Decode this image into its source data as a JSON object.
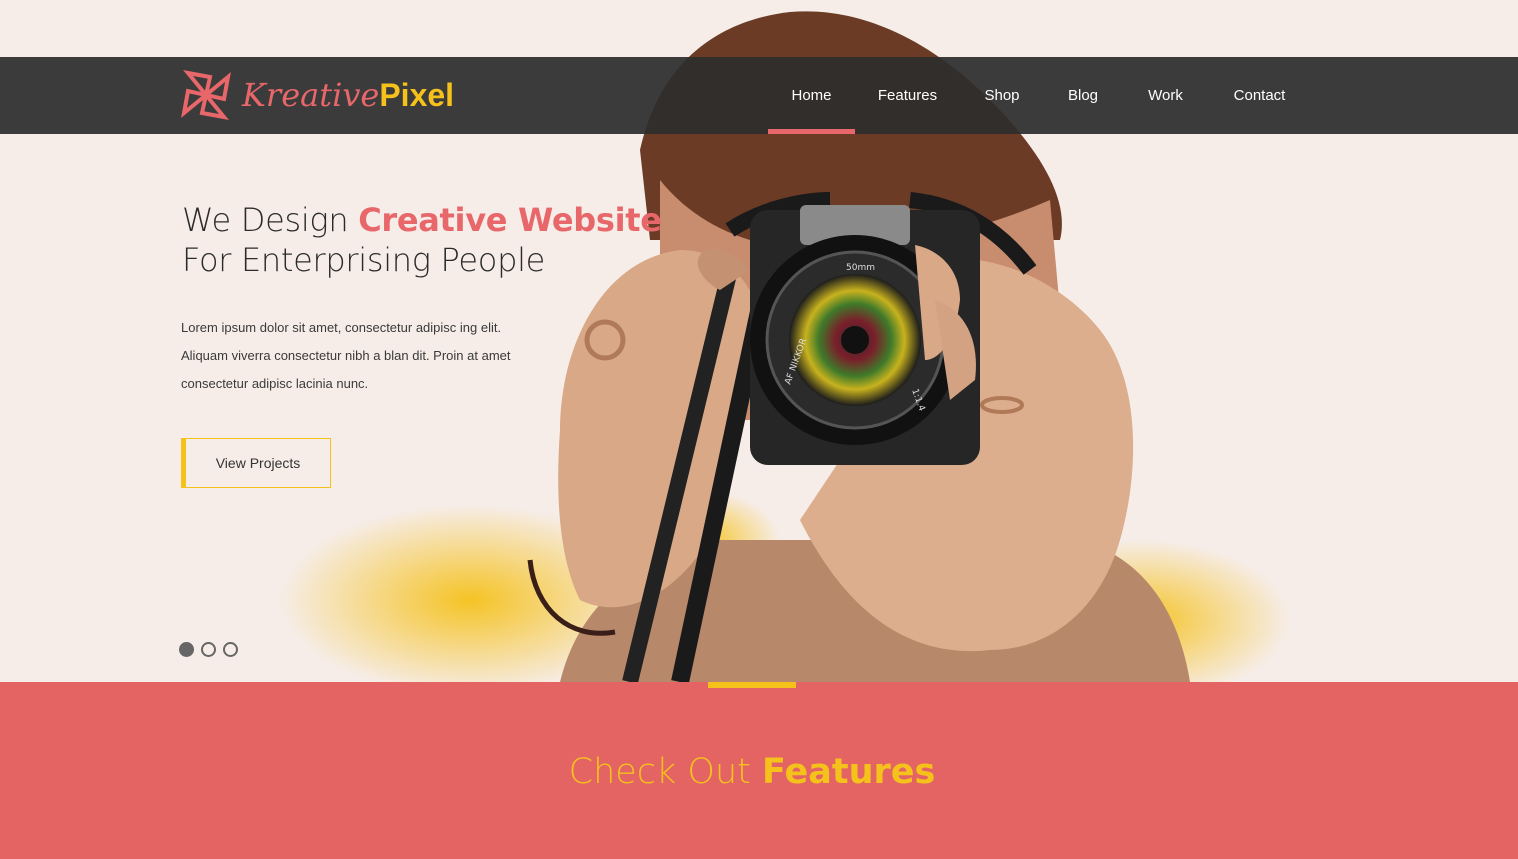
{
  "brand": {
    "name_script": "Kreative",
    "name_bold": "Pixel"
  },
  "nav": {
    "items": [
      {
        "label": "Home",
        "active": true
      },
      {
        "label": "Features",
        "active": false
      },
      {
        "label": "Shop",
        "active": false
      },
      {
        "label": "Blog",
        "active": false
      },
      {
        "label": "Work",
        "active": false
      },
      {
        "label": "Contact",
        "active": false
      }
    ]
  },
  "hero": {
    "headline_line1_plain": "We Design ",
    "headline_line1_highlight": "Creative Website",
    "headline_line2": "For Enterprising People",
    "body_lines": [
      "Lorem ipsum dolor sit amet, consectetur adipisc ing elit.",
      "Aliquam viverra consectetur nibh a blan dit. Proin at amet",
      "consectetur adipisc lacinia nunc."
    ],
    "cta_label": "View Projects",
    "lens_label": "AF NIKKOR",
    "lens_focal": "50mm",
    "lens_aperture": "1:1.4",
    "slides": {
      "count": 3,
      "active_index": 0
    }
  },
  "features": {
    "title_plain": "Check Out ",
    "title_highlight": "Features"
  },
  "colors": {
    "accent_coral": "#e8676a",
    "accent_yellow": "#f5c11b",
    "navbar": "#2d2d2d",
    "hero_bg": "#f6ede8",
    "features_bg": "#e46464"
  },
  "icons": {
    "logo": "pinwheel-logo-icon"
  }
}
